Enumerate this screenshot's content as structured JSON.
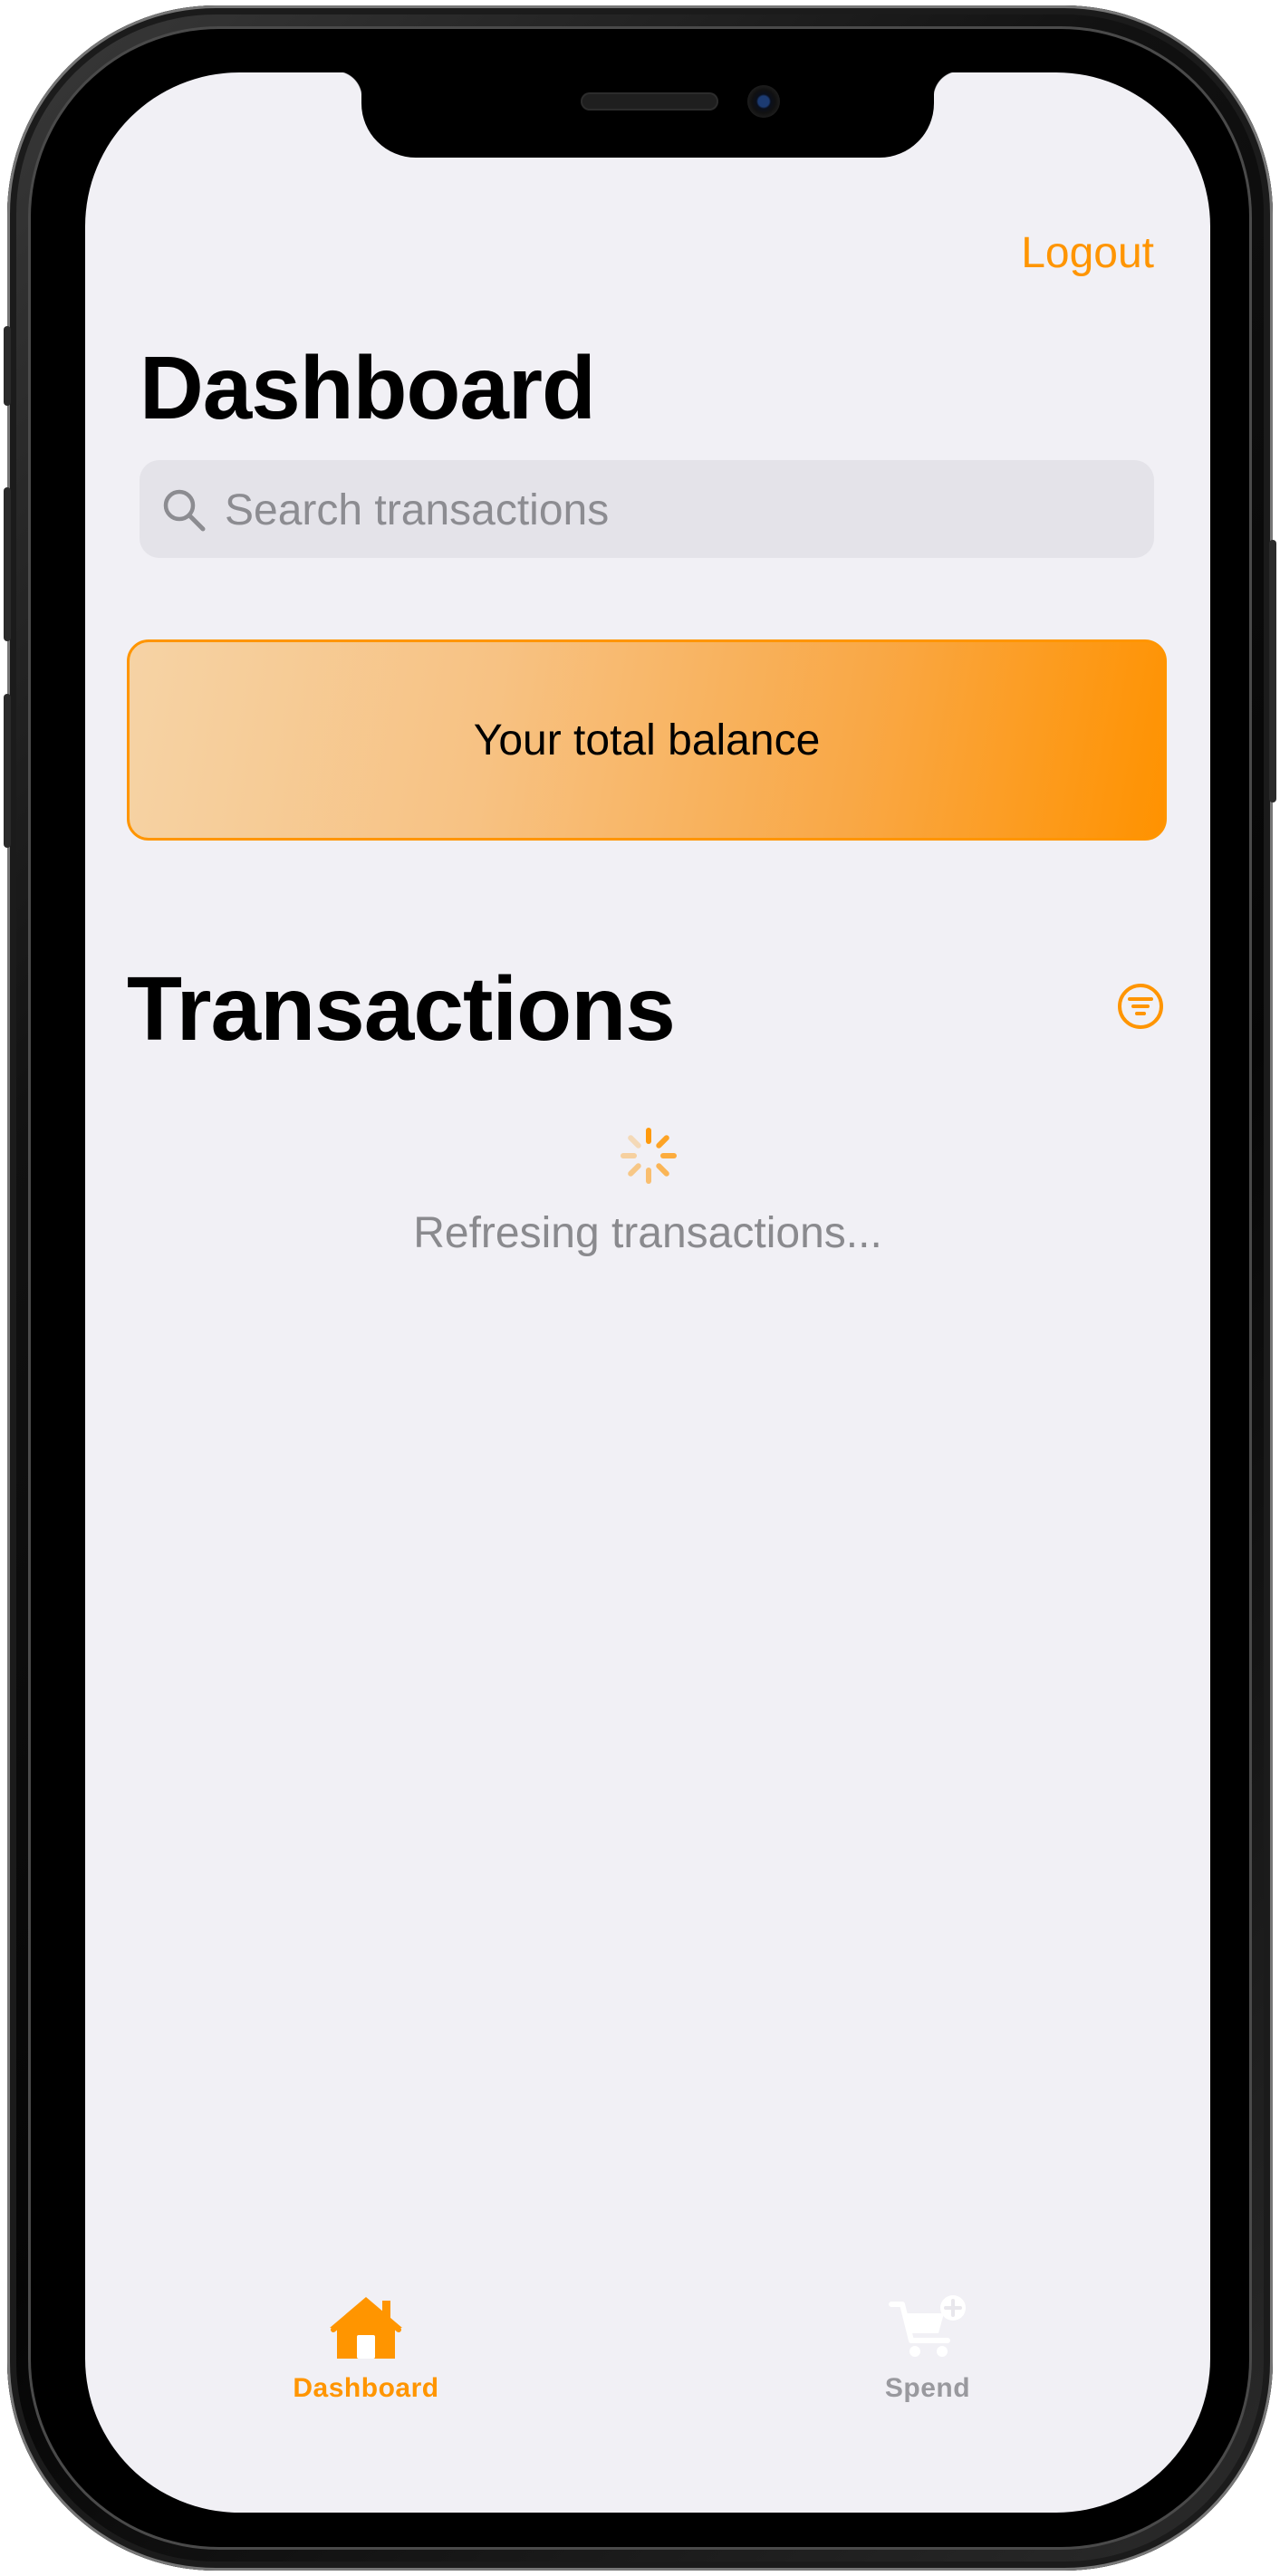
{
  "header": {
    "logout_label": "Logout",
    "title": "Dashboard"
  },
  "search": {
    "placeholder": "Search transactions",
    "value": ""
  },
  "balance": {
    "label": "Your total balance"
  },
  "transactions": {
    "title": "Transactions",
    "status_text": "Refresing transactions..."
  },
  "tab_bar": {
    "items": [
      {
        "label": "Dashboard",
        "icon": "house-icon",
        "selected": true
      },
      {
        "label": "Spend",
        "icon": "cart-plus-icon",
        "selected": false
      }
    ]
  },
  "colors": {
    "accent": "#ff9500",
    "background": "#f1f0f5",
    "search_field": "#e4e3e9",
    "inactive_tab": "#99999e",
    "secondary_text": "#8a8a8e"
  },
  "icons": {
    "search": "search-icon",
    "filter": "filter-icon",
    "spinner": "spinner-icon"
  }
}
